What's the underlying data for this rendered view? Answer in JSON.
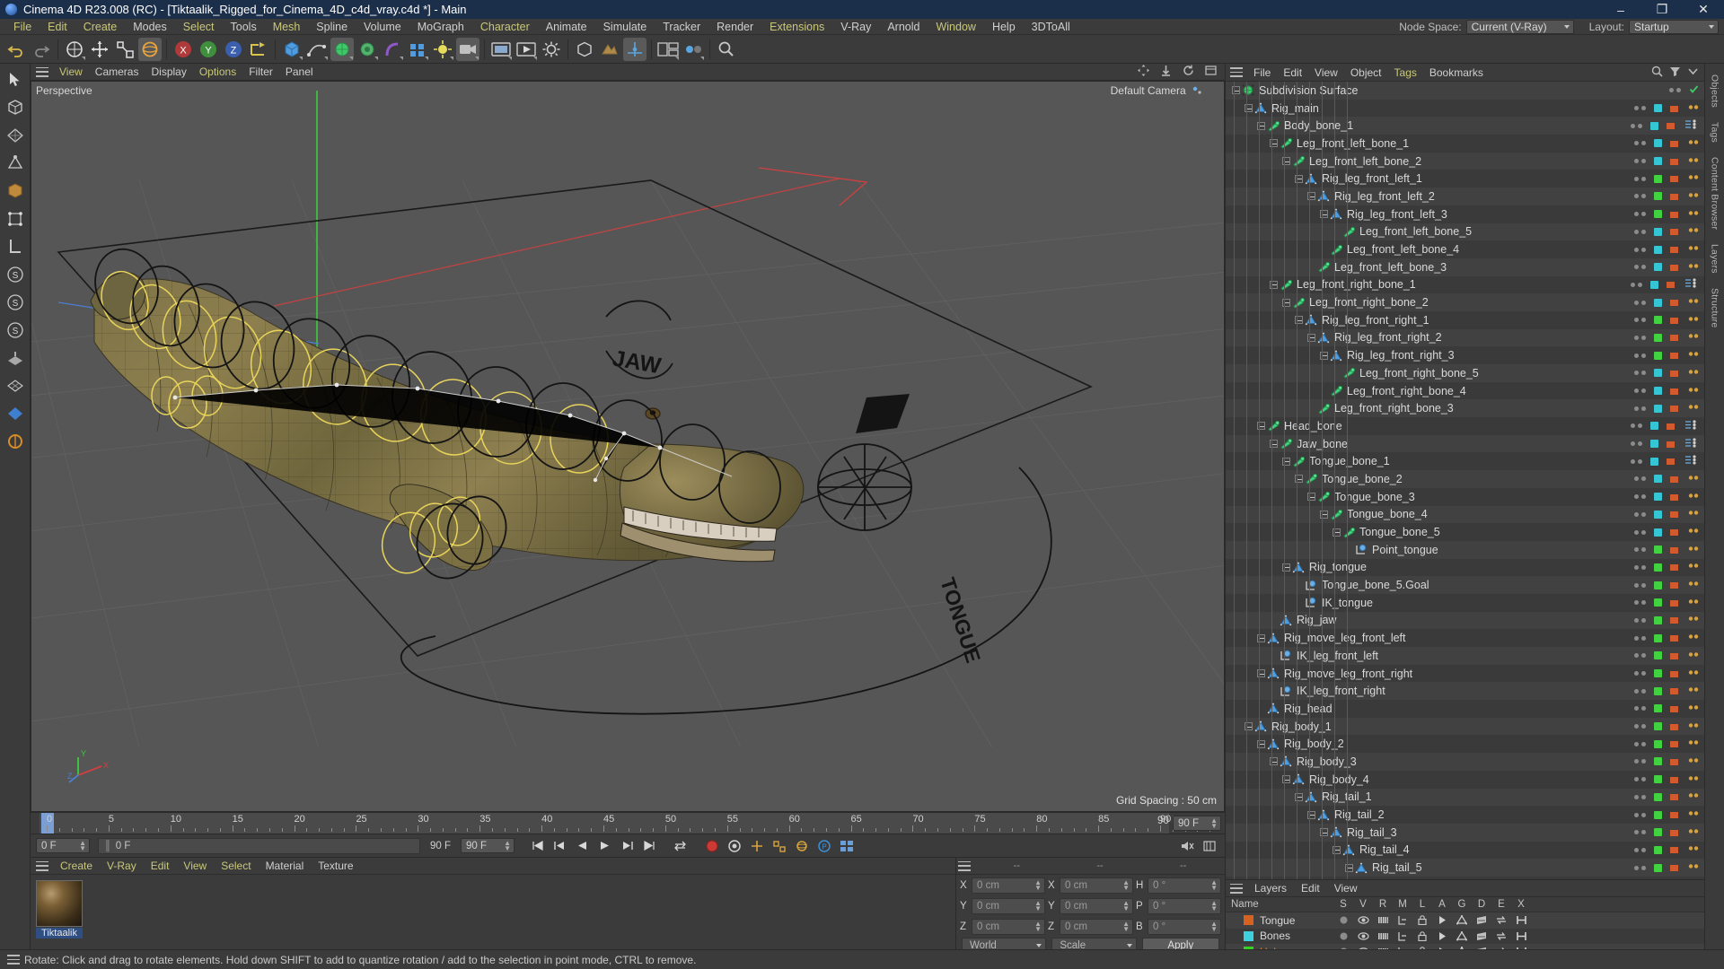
{
  "window": {
    "title": "Cinema 4D R23.008 (RC) - [Tiktaalik_Rigged_for_Cinema_4D_c4d_vray.c4d *] - Main",
    "minimize": "–",
    "maximize": "❐",
    "close": "✕"
  },
  "menubar": {
    "items": [
      {
        "label": "File",
        "hl": true
      },
      {
        "label": "Edit",
        "hl": true
      },
      {
        "label": "Create",
        "hl": true
      },
      {
        "label": "Modes",
        "hl": false
      },
      {
        "label": "Select",
        "hl": true
      },
      {
        "label": "Tools",
        "hl": false
      },
      {
        "label": "Mesh",
        "hl": true
      },
      {
        "label": "Spline",
        "hl": false
      },
      {
        "label": "Volume",
        "hl": false
      },
      {
        "label": "MoGraph",
        "hl": false
      },
      {
        "label": "Character",
        "hl": true
      },
      {
        "label": "Animate",
        "hl": false
      },
      {
        "label": "Simulate",
        "hl": false
      },
      {
        "label": "Tracker",
        "hl": false
      },
      {
        "label": "Render",
        "hl": false
      },
      {
        "label": "Extensions",
        "hl": true
      },
      {
        "label": "V-Ray",
        "hl": false
      },
      {
        "label": "Arnold",
        "hl": false
      },
      {
        "label": "Window",
        "hl": true
      },
      {
        "label": "Help",
        "hl": false
      },
      {
        "label": "3DToAll",
        "hl": false
      }
    ],
    "node_space_label": "Node Space:",
    "node_space_value": "Current (V-Ray)",
    "layout_label": "Layout:",
    "layout_value": "Startup"
  },
  "viewport": {
    "menu": [
      {
        "label": "View",
        "hl": true
      },
      {
        "label": "Cameras",
        "hl": false
      },
      {
        "label": "Display",
        "hl": false
      },
      {
        "label": "Options",
        "hl": true
      },
      {
        "label": "Filter",
        "hl": false
      },
      {
        "label": "Panel",
        "hl": false
      }
    ],
    "label_left": "Perspective",
    "label_right": "Default Camera",
    "grid_spacing": "Grid Spacing : 50 cm",
    "axis_x": "X",
    "axis_y": "Y",
    "axis_z": "Z",
    "annotation_jaw": "JAW",
    "annotation_tongue": "TONGUE"
  },
  "timeline": {
    "ticks": [
      "0",
      "5",
      "10",
      "15",
      "20",
      "25",
      "30",
      "35",
      "40",
      "45",
      "50",
      "55",
      "60",
      "65",
      "70",
      "75",
      "80",
      "85",
      "90"
    ],
    "current_frame": "0 F",
    "current_frame_field": "0 F",
    "range_end": "90 F",
    "range_end_field": "90 F",
    "preview_start": "0 F"
  },
  "materials": {
    "menu": [
      {
        "label": "Create",
        "hl": true
      },
      {
        "label": "V-Ray",
        "hl": true
      },
      {
        "label": "Edit",
        "hl": true
      },
      {
        "label": "View",
        "hl": true
      },
      {
        "label": "Select",
        "hl": true
      },
      {
        "label": "Material",
        "hl": false
      },
      {
        "label": "Texture",
        "hl": false
      }
    ],
    "items": [
      {
        "name": "Tiktaalik"
      }
    ]
  },
  "coordinates": {
    "header": [
      "--",
      "--",
      "--"
    ],
    "rows": [
      {
        "l1": "X",
        "v1": "0 cm",
        "l2": "X",
        "v2": "0 cm",
        "l3": "H",
        "v3": "0 °"
      },
      {
        "l1": "Y",
        "v1": "0 cm",
        "l2": "Y",
        "v2": "0 cm",
        "l3": "P",
        "v3": "0 °"
      },
      {
        "l1": "Z",
        "v1": "0 cm",
        "l2": "Z",
        "v2": "0 cm",
        "l3": "B",
        "v3": "0 °"
      }
    ],
    "world_select": "World",
    "scale_select": "Scale",
    "apply_button": "Apply"
  },
  "object_manager": {
    "menu": [
      {
        "label": "File",
        "hl": false
      },
      {
        "label": "Edit",
        "hl": false
      },
      {
        "label": "View",
        "hl": false
      },
      {
        "label": "Object",
        "hl": false
      },
      {
        "label": "Tags",
        "hl": true
      },
      {
        "label": "Bookmarks",
        "hl": false
      }
    ],
    "rows": [
      {
        "name": "Subdivision Surface",
        "depth": 0,
        "icon": "subdivision",
        "expander": true,
        "tags": "check"
      },
      {
        "name": "Rig_main",
        "depth": 1,
        "icon": "null",
        "expander": true,
        "tags": "cyan"
      },
      {
        "name": "Body_bone_1",
        "depth": 2,
        "icon": "bone",
        "expander": true,
        "tags": "cyan+weight"
      },
      {
        "name": "Leg_front_left_bone_1",
        "depth": 3,
        "icon": "bone",
        "expander": true,
        "tags": "cyan"
      },
      {
        "name": "Leg_front_left_bone_2",
        "depth": 4,
        "icon": "bone",
        "expander": true,
        "tags": "cyan"
      },
      {
        "name": "Rig_leg_front_left_1",
        "depth": 5,
        "icon": "null",
        "expander": true,
        "tags": "green"
      },
      {
        "name": "Rig_leg_front_left_2",
        "depth": 6,
        "icon": "null",
        "expander": true,
        "tags": "green"
      },
      {
        "name": "Rig_leg_front_left_3",
        "depth": 7,
        "icon": "null",
        "expander": true,
        "tags": "green"
      },
      {
        "name": "Leg_front_left_bone_5",
        "depth": 8,
        "icon": "bone",
        "expander": false,
        "tags": "cyan"
      },
      {
        "name": "Leg_front_left_bone_4",
        "depth": 7,
        "icon": "bone",
        "expander": false,
        "tags": "cyan"
      },
      {
        "name": "Leg_front_left_bone_3",
        "depth": 6,
        "icon": "bone",
        "expander": false,
        "tags": "cyan"
      },
      {
        "name": "Leg_front_right_bone_1",
        "depth": 3,
        "icon": "bone",
        "expander": true,
        "tags": "cyan+weight"
      },
      {
        "name": "Leg_front_right_bone_2",
        "depth": 4,
        "icon": "bone",
        "expander": true,
        "tags": "cyan"
      },
      {
        "name": "Rig_leg_front_right_1",
        "depth": 5,
        "icon": "null",
        "expander": true,
        "tags": "green"
      },
      {
        "name": "Rig_leg_front_right_2",
        "depth": 6,
        "icon": "null",
        "expander": true,
        "tags": "green"
      },
      {
        "name": "Rig_leg_front_right_3",
        "depth": 7,
        "icon": "null",
        "expander": true,
        "tags": "green"
      },
      {
        "name": "Leg_front_right_bone_5",
        "depth": 8,
        "icon": "bone",
        "expander": false,
        "tags": "cyan"
      },
      {
        "name": "Leg_front_right_bone_4",
        "depth": 7,
        "icon": "bone",
        "expander": false,
        "tags": "cyan"
      },
      {
        "name": "Leg_front_right_bone_3",
        "depth": 6,
        "icon": "bone",
        "expander": false,
        "tags": "cyan"
      },
      {
        "name": "Head_bone",
        "depth": 2,
        "icon": "bone",
        "expander": true,
        "tags": "cyan+weight"
      },
      {
        "name": "Jaw_bone",
        "depth": 3,
        "icon": "bone",
        "expander": true,
        "tags": "cyan+weight"
      },
      {
        "name": "Tongue_bone_1",
        "depth": 4,
        "icon": "bone",
        "expander": true,
        "tags": "cyan+weight"
      },
      {
        "name": "Tongue_bone_2",
        "depth": 5,
        "icon": "bone",
        "expander": true,
        "tags": "cyan"
      },
      {
        "name": "Tongue_bone_3",
        "depth": 6,
        "icon": "bone",
        "expander": true,
        "tags": "cyan"
      },
      {
        "name": "Tongue_bone_4",
        "depth": 7,
        "icon": "bone",
        "expander": true,
        "tags": "cyan"
      },
      {
        "name": "Tongue_bone_5",
        "depth": 8,
        "icon": "bone",
        "expander": true,
        "tags": "cyan"
      },
      {
        "name": "Point_tongue",
        "depth": 9,
        "icon": "goal",
        "expander": false,
        "tags": "green"
      },
      {
        "name": "Rig_tongue",
        "depth": 4,
        "icon": "null",
        "expander": true,
        "tags": "green"
      },
      {
        "name": "Tongue_bone_5.Goal",
        "depth": 5,
        "icon": "goal",
        "expander": false,
        "tags": "green"
      },
      {
        "name": "IK_tongue",
        "depth": 5,
        "icon": "goal",
        "expander": false,
        "tags": "green"
      },
      {
        "name": "Rig_jaw",
        "depth": 3,
        "icon": "null",
        "expander": false,
        "tags": "green"
      },
      {
        "name": "Rig_move_leg_front_left",
        "depth": 2,
        "icon": "null",
        "expander": true,
        "tags": "green"
      },
      {
        "name": "IK_leg_front_left",
        "depth": 3,
        "icon": "goal",
        "expander": false,
        "tags": "green"
      },
      {
        "name": "Rig_move_leg_front_right",
        "depth": 2,
        "icon": "null",
        "expander": true,
        "tags": "green"
      },
      {
        "name": "IK_leg_front_right",
        "depth": 3,
        "icon": "goal",
        "expander": false,
        "tags": "green"
      },
      {
        "name": "Rig_head",
        "depth": 2,
        "icon": "null",
        "expander": false,
        "tags": "green"
      },
      {
        "name": "Rig_body_1",
        "depth": 1,
        "icon": "null",
        "expander": true,
        "tags": "green"
      },
      {
        "name": "Rig_body_2",
        "depth": 2,
        "icon": "null",
        "expander": true,
        "tags": "green"
      },
      {
        "name": "Rig_body_3",
        "depth": 3,
        "icon": "null",
        "expander": true,
        "tags": "green"
      },
      {
        "name": "Rig_body_4",
        "depth": 4,
        "icon": "null",
        "expander": true,
        "tags": "green"
      },
      {
        "name": "Rig_tail_1",
        "depth": 5,
        "icon": "null",
        "expander": true,
        "tags": "green"
      },
      {
        "name": "Rig_tail_2",
        "depth": 6,
        "icon": "null",
        "expander": true,
        "tags": "green"
      },
      {
        "name": "Rig_tail_3",
        "depth": 7,
        "icon": "null",
        "expander": true,
        "tags": "green"
      },
      {
        "name": "Rig_tail_4",
        "depth": 8,
        "icon": "null",
        "expander": true,
        "tags": "green"
      },
      {
        "name": "Rig_tail_5",
        "depth": 9,
        "icon": "null",
        "expander": true,
        "tags": "green"
      }
    ]
  },
  "layer_manager": {
    "menu": [
      {
        "label": "Layers",
        "hl": false
      },
      {
        "label": "Edit",
        "hl": false
      },
      {
        "label": "View",
        "hl": false
      }
    ],
    "columns": [
      "Name",
      "S",
      "V",
      "R",
      "M",
      "L",
      "A",
      "G",
      "D",
      "E",
      "X"
    ],
    "rows": [
      {
        "name": "Tongue",
        "color": "#d5621f",
        "highlight": false
      },
      {
        "name": "Bones",
        "color": "#3fd0dd",
        "highlight": false
      },
      {
        "name": "Helpers",
        "color": "#35d321",
        "highlight": true
      }
    ]
  },
  "right_tabs": [
    "Objects",
    "Tags",
    "Content Browser",
    "Layers",
    "Structure"
  ],
  "statusbar": {
    "text": "Rotate: Click and drag to rotate elements. Hold down SHIFT to add to quantize rotation / add to the selection in point mode, CTRL to remove."
  },
  "colors": {
    "accent_yellow": "#c9c87a",
    "cyan_tag": "#34c6d4",
    "green_tag": "#41d23f",
    "panel_bg": "#3b3b3b",
    "viewport_bg": "#565656"
  }
}
